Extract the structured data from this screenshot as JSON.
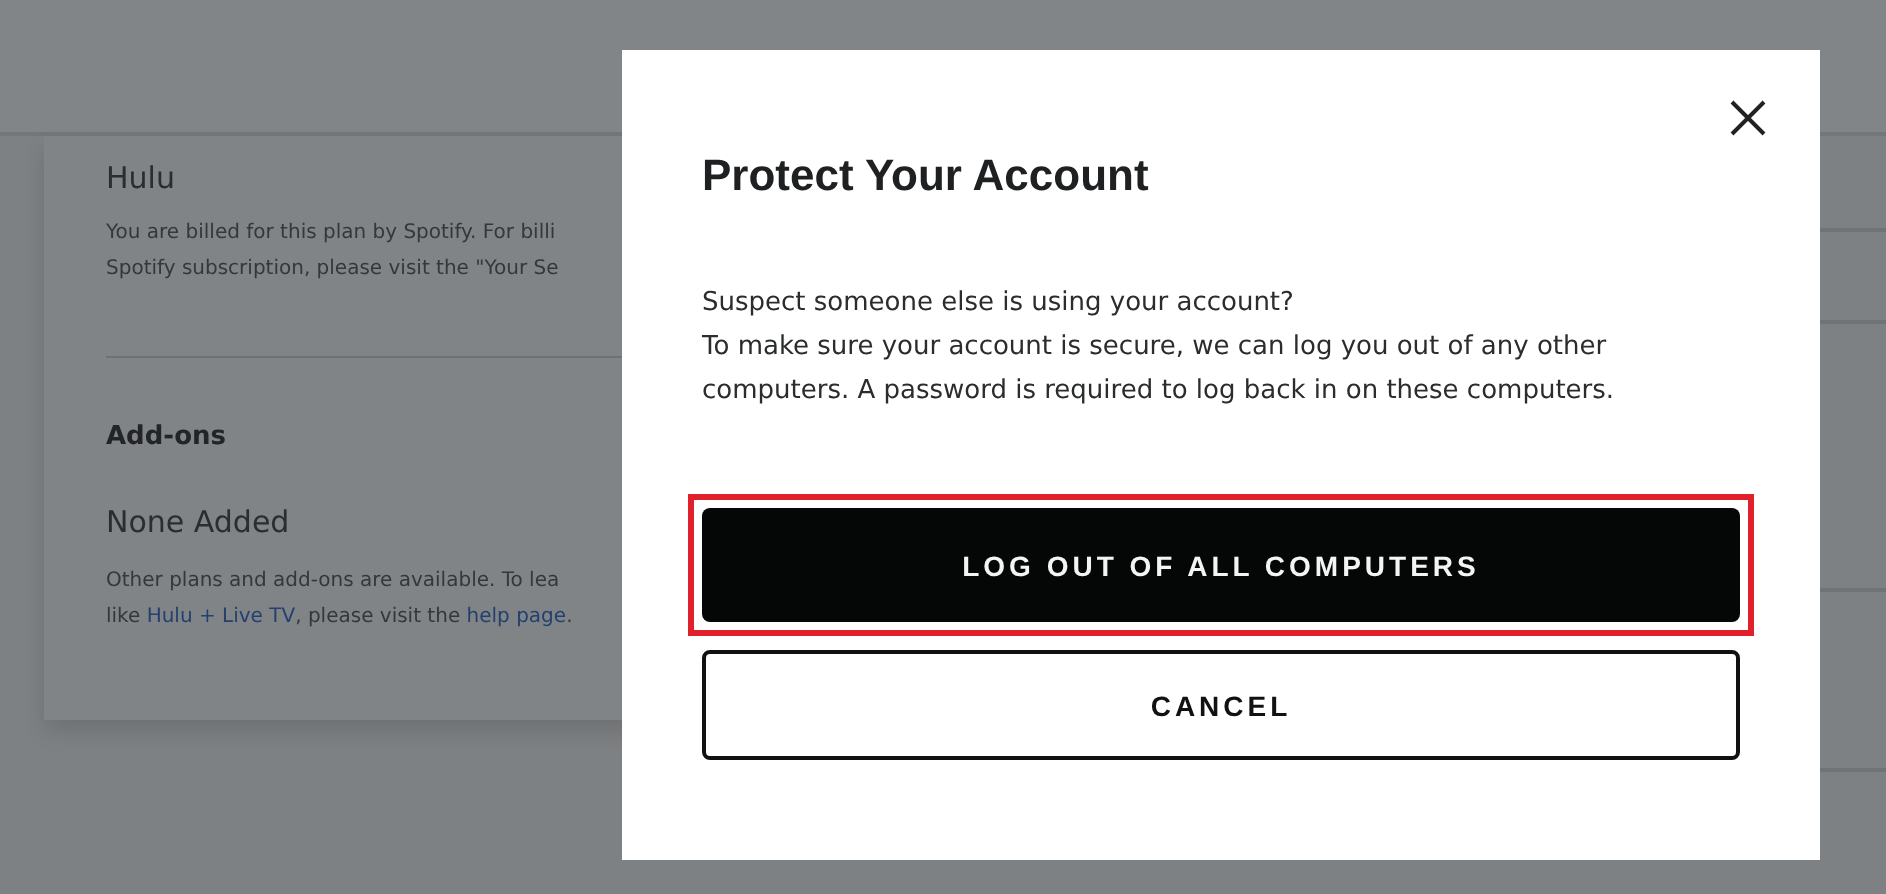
{
  "background_page": {
    "plan_name": "Hulu",
    "plan_note_lines": [
      "You are billed for this plan by Spotify. For billi",
      "Spotify subscription, please visit the \"Your Se"
    ],
    "addons_heading": "Add-ons",
    "addons_value": "None Added",
    "addons_note_line_1": "Other plans and add-ons are available. To lea",
    "addons_note_line_2": [
      {
        "kind": "text",
        "text": "like "
      },
      {
        "kind": "link",
        "text": "Hulu + Live TV"
      },
      {
        "kind": "text",
        "text": ", please visit the "
      },
      {
        "kind": "link",
        "text": "help page"
      },
      {
        "kind": "text",
        "text": "."
      }
    ]
  },
  "dialog": {
    "title": "Protect Your Account",
    "body_lines": [
      "Suspect someone else is using your account?",
      "To make sure your account is secure, we can log you out of any other computers. A password is required to log back in on these computers."
    ],
    "buttons": [
      {
        "label": "LOG OUT OF ALL COMPUTERS",
        "kind": "primary",
        "highlighted": true
      },
      {
        "label": "CANCEL",
        "kind": "secondary",
        "highlighted": false
      }
    ]
  }
}
